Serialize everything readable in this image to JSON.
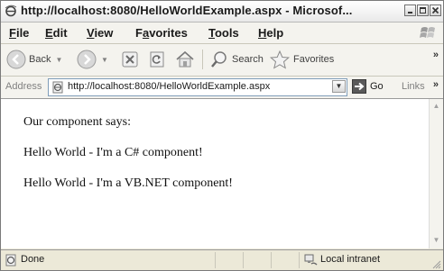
{
  "window": {
    "title": "http://localhost:8080/HelloWorldExample.aspx - Microsof..."
  },
  "menu": {
    "items": [
      {
        "label": "File",
        "accel": "F",
        "rest": "ile"
      },
      {
        "label": "Edit",
        "accel": "E",
        "rest": "dit"
      },
      {
        "label": "View",
        "accel": "V",
        "rest": "iew"
      },
      {
        "label": "Favorites",
        "accel": "a",
        "pre": "F",
        "rest": "vorites"
      },
      {
        "label": "Tools",
        "accel": "T",
        "rest": "ools"
      },
      {
        "label": "Help",
        "accel": "H",
        "rest": "elp"
      }
    ]
  },
  "toolbar": {
    "back_label": "Back",
    "search_label": "Search",
    "favorites_label": "Favorites",
    "overflow_label": "»"
  },
  "address": {
    "label": "Address",
    "url": "http://localhost:8080/HelloWorldExample.aspx",
    "go_label": "Go",
    "links_label": "Links",
    "links_overflow": "»"
  },
  "page": {
    "lines": [
      "Our component says:",
      "Hello World - I'm a C# component!",
      "Hello World - I'm a VB.NET component!"
    ]
  },
  "status": {
    "text": "Done",
    "zone": "Local intranet"
  },
  "colors": {
    "chrome": "#ece9d8",
    "toolbar": "#f4f3ee",
    "address_border": "#7f9db9"
  }
}
